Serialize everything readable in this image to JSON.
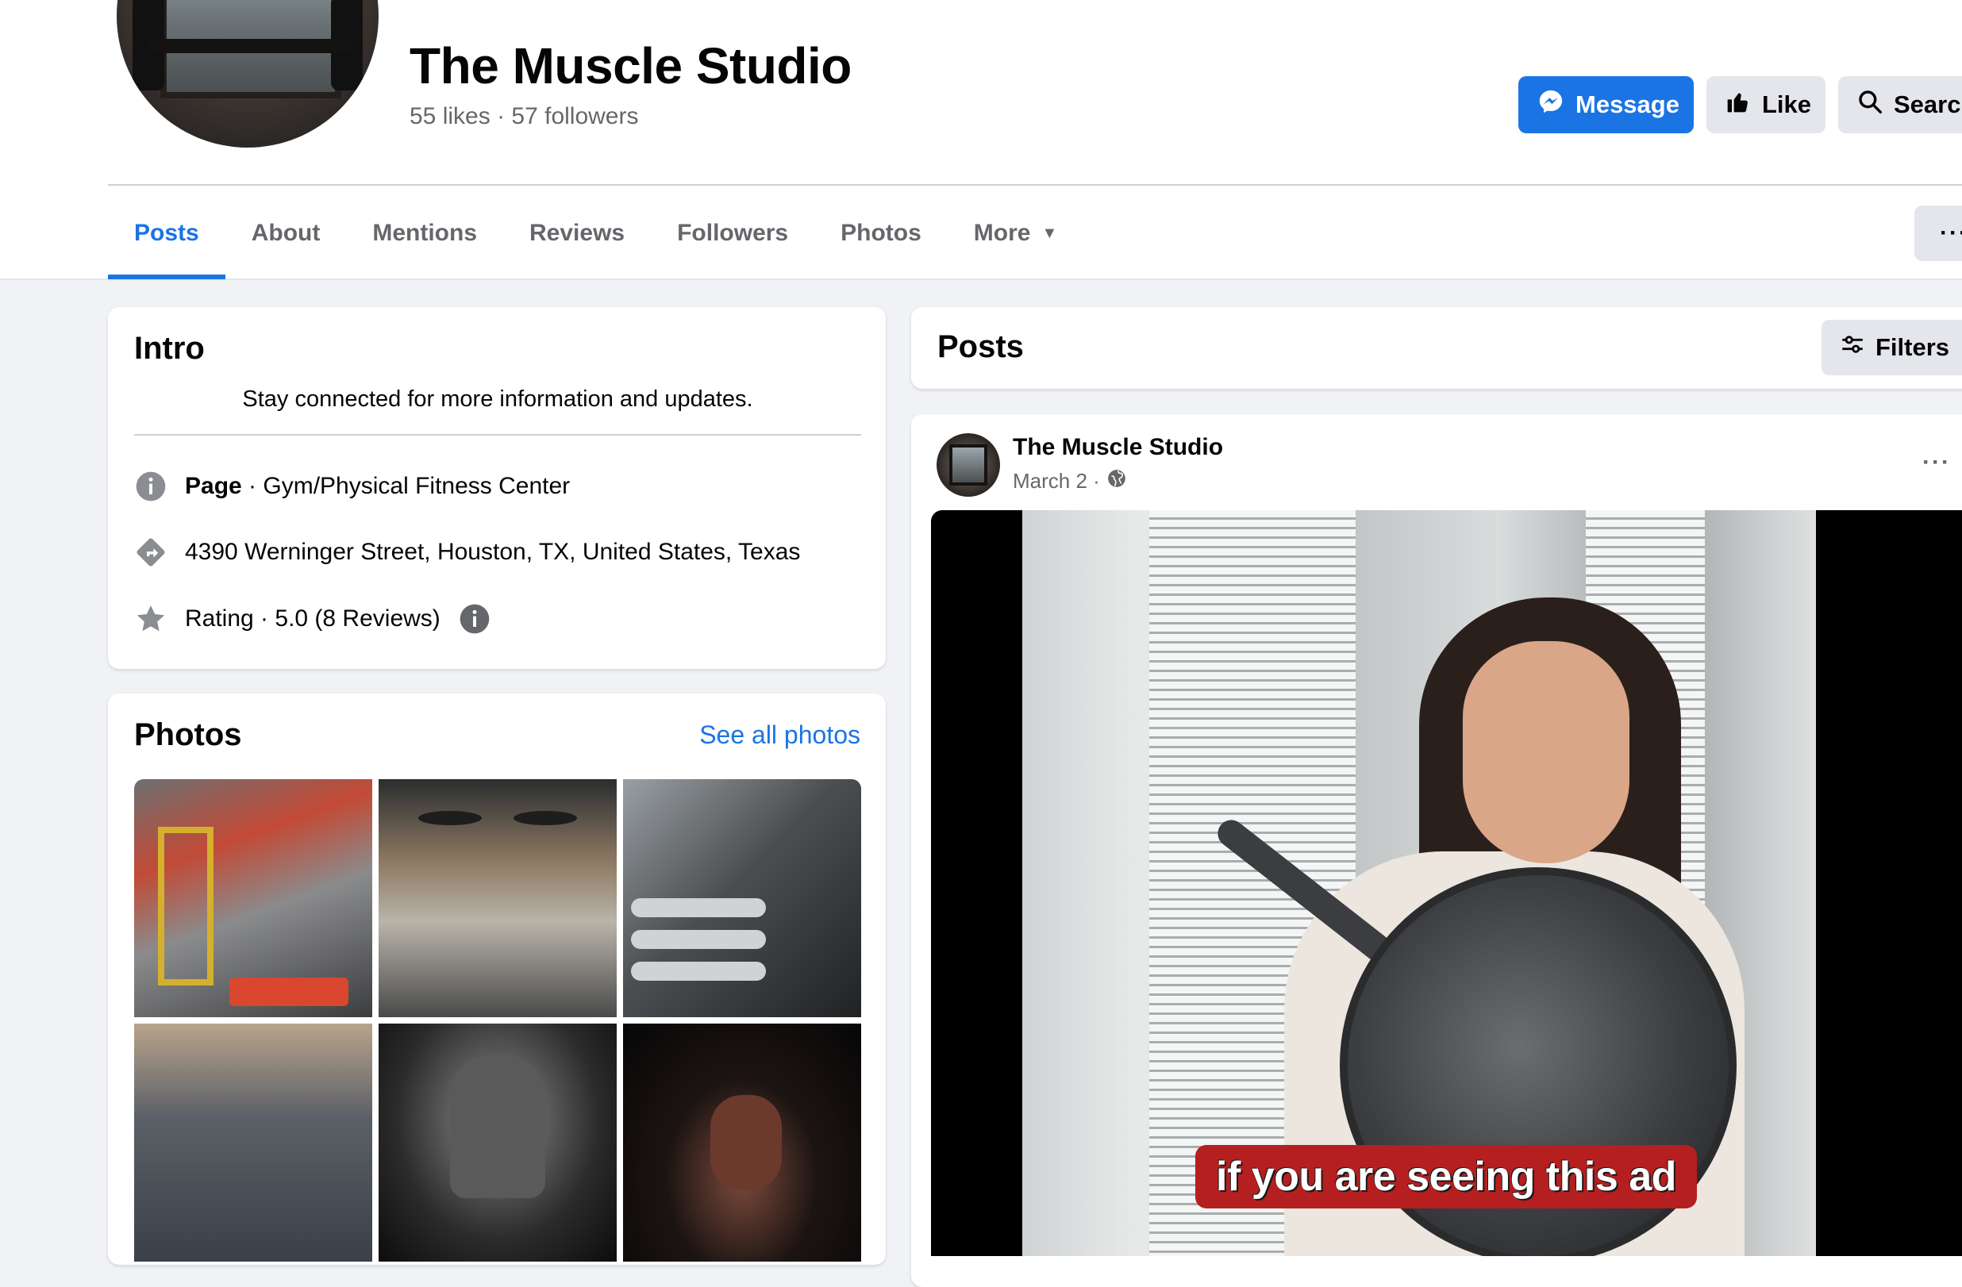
{
  "page": {
    "title": "The Muscle Studio",
    "likes": "55 likes",
    "separator": "·",
    "followers": "57 followers"
  },
  "actions": {
    "message_label": "Message",
    "like_label": "Like",
    "search_label": "Search"
  },
  "tabs": [
    {
      "label": "Posts",
      "active": true
    },
    {
      "label": "About"
    },
    {
      "label": "Mentions"
    },
    {
      "label": "Reviews"
    },
    {
      "label": "Followers"
    },
    {
      "label": "Photos"
    },
    {
      "label": "More"
    }
  ],
  "more_menu_label": "···",
  "intro": {
    "title": "Intro",
    "bio": "Stay connected for more information and updates.",
    "category_label": "Page",
    "category_value": " · Gym/Physical Fitness Center",
    "address": "4390 Werninger Street, Houston, TX, United States, Texas",
    "rating": "Rating · 5.0 (8 Reviews)"
  },
  "photos": {
    "title": "Photos",
    "see_all": "See all photos"
  },
  "posts_header": {
    "title": "Posts",
    "filters_label": "Filters"
  },
  "post": {
    "author": "The Muscle Studio",
    "date": "March 2 ·",
    "menu": "···",
    "caption": "if you are seeing this ad"
  },
  "colors": {
    "accent": "#1b74e4",
    "secondary_text": "#65676b",
    "button_bg": "#e4e6eb",
    "caption_bg": "#b51f1f"
  }
}
